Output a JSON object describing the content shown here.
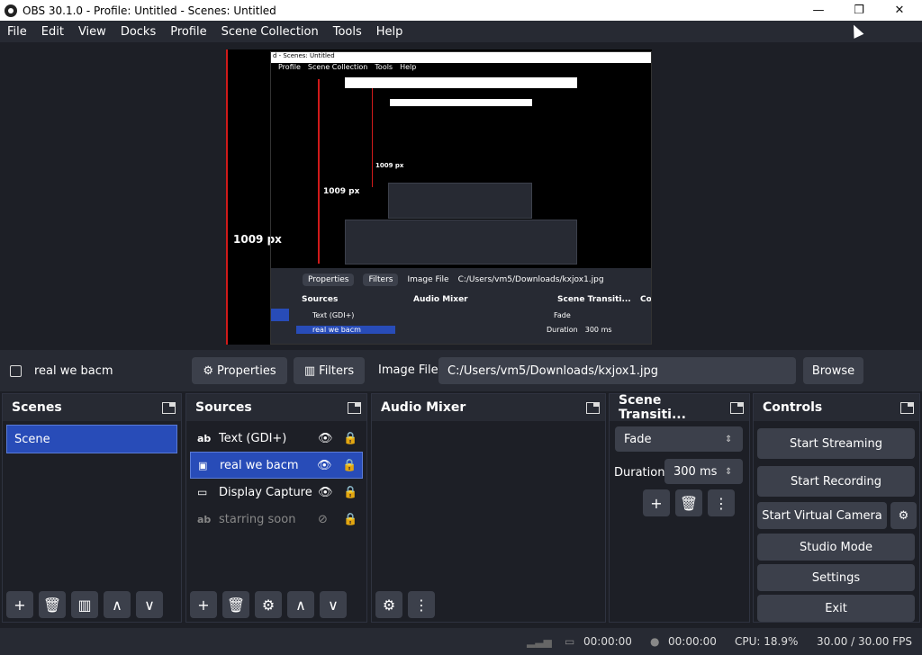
{
  "window": {
    "title": "OBS 30.1.0 - Profile: Untitled - Scenes: Untitled",
    "minimize": "—",
    "maximize": "❐",
    "close": "✕"
  },
  "menu": [
    "File",
    "Edit",
    "View",
    "Docks",
    "Profile",
    "Scene Collection",
    "Tools",
    "Help"
  ],
  "preview": {
    "label1": "1009 px",
    "label2": "1009 px",
    "label3": "1009 px",
    "nested_title": "d - Scenes: Untitled",
    "nested_menu": [
      "Profile",
      "Scene Collection",
      "Tools",
      "Help"
    ],
    "nested_ctx": {
      "properties": "Properties",
      "filters": "Filters",
      "image_file": "Image File",
      "path": "C:/Users/vm5/Downloads/kxjox1.jpg"
    },
    "nested_docks": {
      "sources": "Sources",
      "audio": "Audio Mixer",
      "transitions": "Scene Transiti...",
      "controls": "Co",
      "fade": "Fade",
      "duration": "Duration",
      "duration_val": "300 ms",
      "src1": "Text (GDI+)",
      "src2": "real we bacm"
    }
  },
  "context": {
    "source_name": "real we bacm",
    "properties": "Properties",
    "filters": "Filters",
    "image_file_label": "Image File",
    "path": "C:/Users/vm5/Downloads/kxjox1.jpg",
    "browse": "Browse"
  },
  "scenes": {
    "title": "Scenes",
    "items": [
      "Scene"
    ]
  },
  "sources": {
    "title": "Sources",
    "items": [
      {
        "type": "ab",
        "name": "Text (GDI+)",
        "visible": true
      },
      {
        "type": "img",
        "name": "real we bacm",
        "visible": true,
        "selected": true
      },
      {
        "type": "display",
        "name": "Display Capture",
        "visible": true
      },
      {
        "type": "ab",
        "name": "starring soon",
        "visible": false
      }
    ]
  },
  "audio": {
    "title": "Audio Mixer"
  },
  "transitions": {
    "title": "Scene Transiti...",
    "selected": "Fade",
    "duration_label": "Duration",
    "duration": "300 ms"
  },
  "controls": {
    "title": "Controls",
    "start_streaming": "Start Streaming",
    "start_recording": "Start Recording",
    "start_virtual_camera": "Start Virtual Camera",
    "studio_mode": "Studio Mode",
    "settings": "Settings",
    "exit": "Exit"
  },
  "status": {
    "stream_time": "00:00:00",
    "record_time": "00:00:00",
    "cpu": "CPU: 18.9%",
    "fps": "30.00 / 30.00 FPS"
  },
  "colors": {
    "accent": "#284cb8",
    "panel": "#272a33",
    "background": "#1d1f26",
    "button": "#3c404b"
  }
}
